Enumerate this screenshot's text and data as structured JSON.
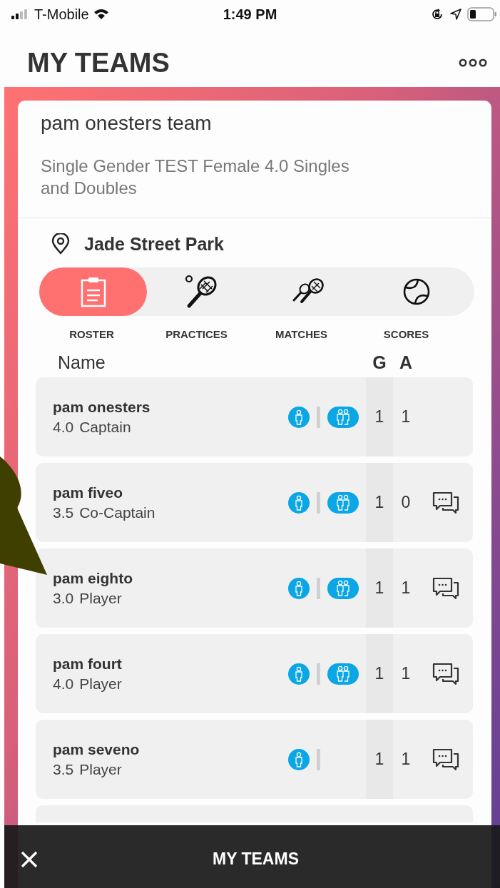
{
  "status_bar": {
    "carrier": "T-Mobile",
    "time": "1:49 PM"
  },
  "header": {
    "title": "MY TEAMS"
  },
  "team": {
    "name": "pam onesters team",
    "description": "Single Gender TEST Female 4.0 Singles and Doubles",
    "location": "Jade Street Park"
  },
  "tabs": [
    {
      "label": "ROSTER",
      "kind": "clipboard",
      "selected": true
    },
    {
      "label": "PRACTICES",
      "kind": "racket",
      "selected": false
    },
    {
      "label": "MATCHES",
      "kind": "rackets",
      "selected": false
    },
    {
      "label": "SCORES",
      "kind": "ball",
      "selected": false
    }
  ],
  "roster": {
    "columns": [
      "Name",
      "G",
      "A"
    ],
    "players": [
      {
        "name": "pam onesters",
        "rating": "4.0",
        "role": "Captain",
        "singles": true,
        "doubles": true,
        "g": "1",
        "a": "1",
        "chat": false
      },
      {
        "name": "pam fiveo",
        "rating": "3.5",
        "role": "Co-Captain",
        "singles": true,
        "doubles": true,
        "g": "1",
        "a": "0",
        "chat": true
      },
      {
        "name": "pam eighto",
        "rating": "3.0",
        "role": "Player",
        "singles": true,
        "doubles": true,
        "g": "1",
        "a": "1",
        "chat": true
      },
      {
        "name": "pam fourt",
        "rating": "4.0",
        "role": "Player",
        "singles": true,
        "doubles": true,
        "g": "1",
        "a": "1",
        "chat": true
      },
      {
        "name": "pam seveno",
        "rating": "3.5",
        "role": "Player",
        "singles": true,
        "doubles": false,
        "g": "1",
        "a": "1",
        "chat": true
      }
    ]
  },
  "bottom_bar": {
    "title": "MY TEAMS"
  }
}
